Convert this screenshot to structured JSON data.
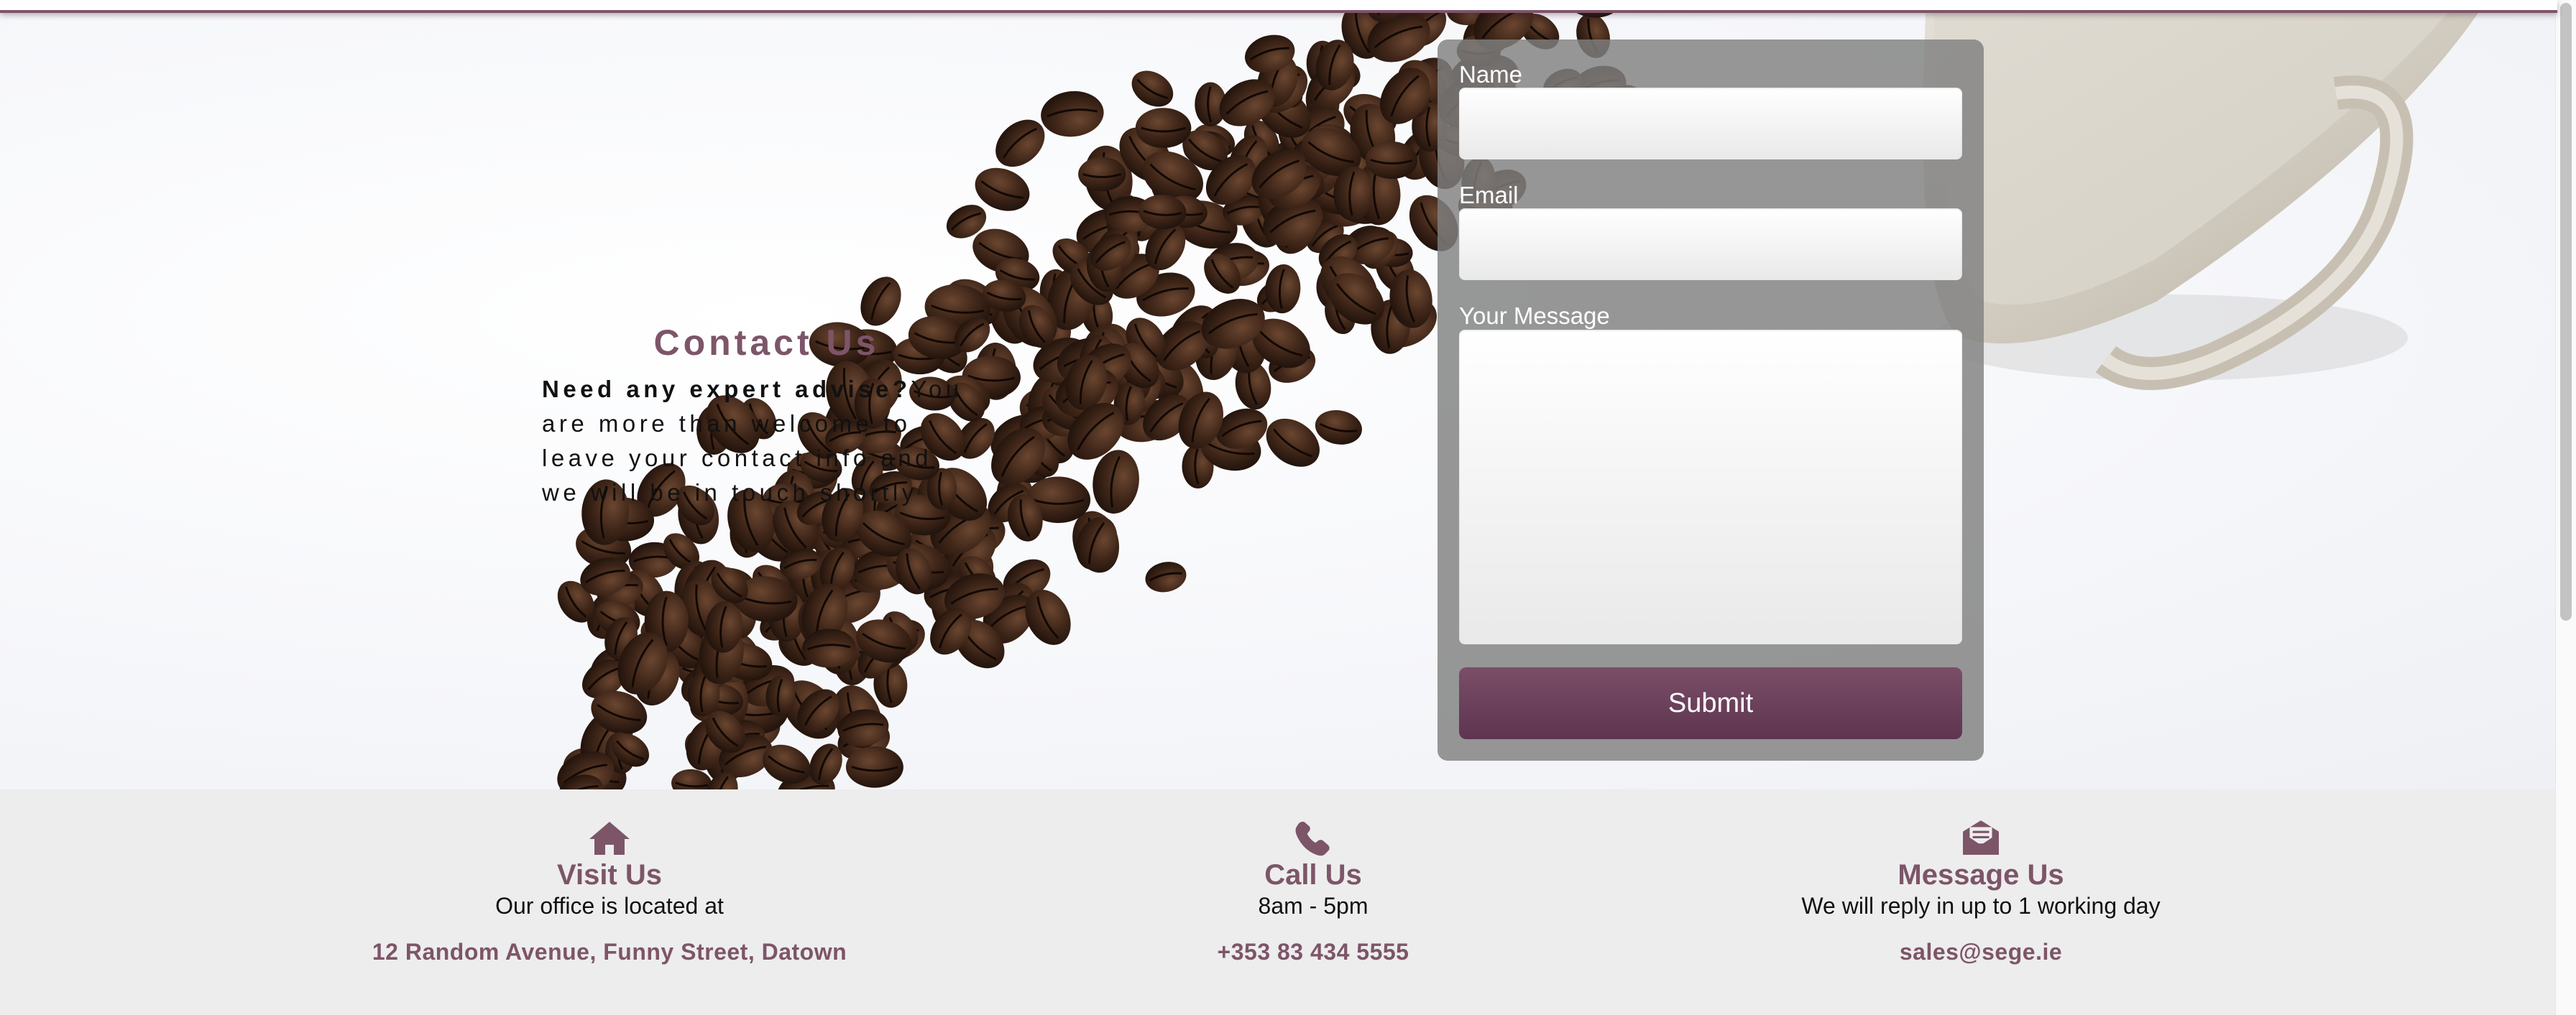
{
  "contact": {
    "title": "Contact Us",
    "lead_bold": "Need any expert advise?",
    "lead_text": "You are more than welcome to leave your contact info and we will be in touch shortly"
  },
  "form": {
    "name_label": "Name",
    "name_value": "",
    "email_label": "Email",
    "email_value": "",
    "message_label": "Your Message",
    "message_value": "",
    "submit_label": "Submit"
  },
  "footer": {
    "visit": {
      "icon": "home-icon",
      "heading": "Visit Us",
      "subtext": "Our office is located at",
      "link": "12 Random Avenue, Funny Street, Datown"
    },
    "call": {
      "icon": "phone-icon",
      "heading": "Call Us",
      "subtext": "8am - 5pm",
      "link": "+353 83 434 5555"
    },
    "message": {
      "icon": "envelope-open-icon",
      "heading": "Message Us",
      "subtext": "We will reply in up to 1 working day",
      "link": "sales@sege.ie"
    }
  },
  "colors": {
    "accent": "#7d5568",
    "button": "#6b3f58",
    "footer_bg": "#ededed",
    "panel": "#808080"
  }
}
